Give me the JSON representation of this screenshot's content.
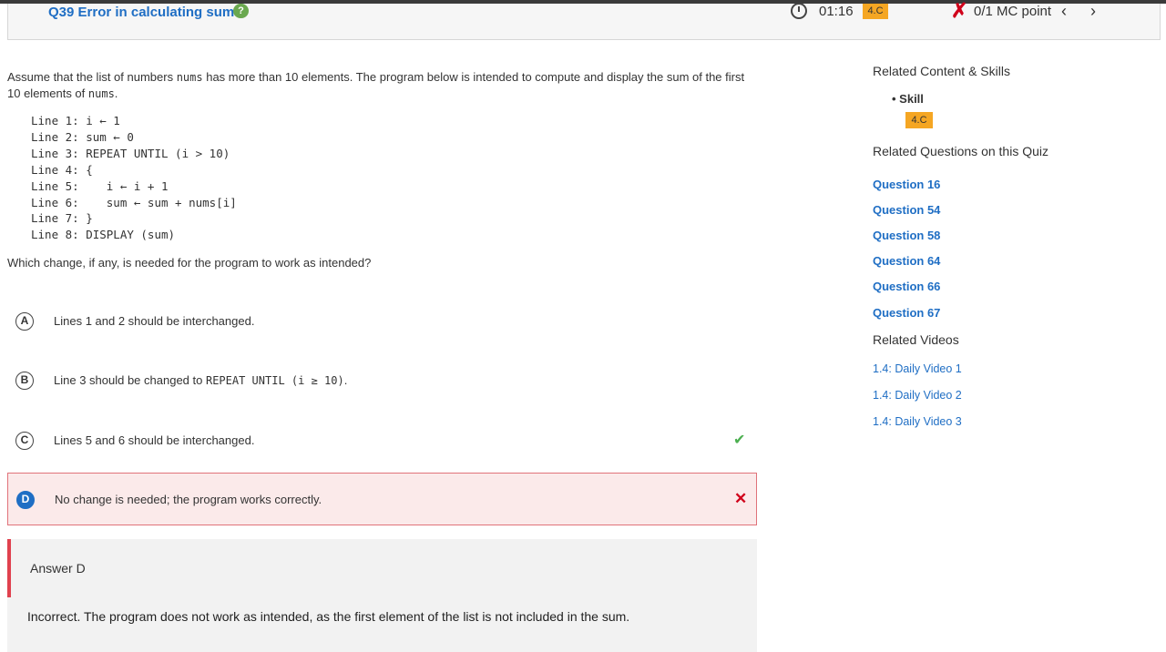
{
  "header": {
    "question_title": "Q39 Error in calculating sum",
    "help_label": "?",
    "timer": "01:16",
    "skill_badge": "4.C",
    "points": "0/1 MC point",
    "prev_label": "‹",
    "next_label": "›"
  },
  "question": {
    "stem_part1": "Assume that the list of numbers ",
    "stem_code1": "nums",
    "stem_part2": " has more than 10 elements. The program below is intended to compute and display the sum of the first 10 elements of ",
    "stem_code2": "nums",
    "stem_part3": ".",
    "code_lines": [
      "Line 1: i ← 1",
      "Line 2: sum ← 0",
      "Line 3: REPEAT UNTIL (i > 10)",
      "Line 4: {",
      "Line 5:    i ← i + 1",
      "Line 6:    sum ← sum + nums[i]",
      "Line 7: }",
      "Line 8: DISPLAY (sum)"
    ],
    "prompt": "Which change, if any, is needed for the program to work as intended?"
  },
  "choices": [
    {
      "letter": "A",
      "text": "Lines 1 and 2 should be interchanged."
    },
    {
      "letter": "B",
      "text_prefix": "Line 3 should be changed to ",
      "text_code": "REPEAT UNTIL (i ≥ 10)",
      "text_suffix": "."
    },
    {
      "letter": "C",
      "text": "Lines 5 and 6 should be interchanged.",
      "mark": "✔"
    },
    {
      "letter": "D",
      "text": "No change is needed; the program works correctly.",
      "mark": "✕"
    }
  ],
  "answer": {
    "label": "Answer D",
    "explanation": "Incorrect. The program does not work as intended, as the first element of the list is not included in the sum."
  },
  "sidebar": {
    "related_heading": "Related Content & Skills",
    "skill_label": "Skill",
    "skill_badge": "4.C",
    "questions_heading": "Related Questions on this Quiz",
    "questions": [
      "Question 16",
      "Question 54",
      "Question 58",
      "Question 64",
      "Question 66",
      "Question 67"
    ],
    "videos_heading": "Related Videos",
    "videos": [
      "1.4: Daily Video 1",
      "1.4: Daily Video 2",
      "1.4: Daily Video 3"
    ]
  },
  "colors": {
    "link_blue": "#1f6ec4",
    "badge_orange": "#f5a623",
    "correct_green": "#4caf50",
    "incorrect_red": "#d0021b"
  }
}
